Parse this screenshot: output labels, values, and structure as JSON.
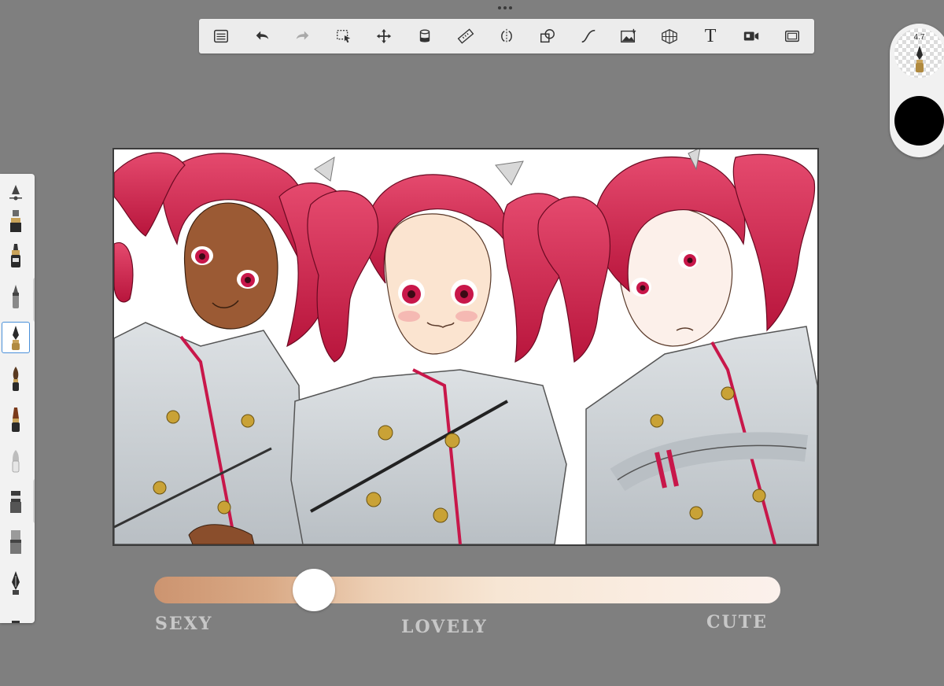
{
  "toolbar": {
    "tools": [
      {
        "name": "list-icon",
        "label": ""
      },
      {
        "name": "undo-icon",
        "label": ""
      },
      {
        "name": "redo-icon",
        "label": ""
      },
      {
        "name": "selection-icon",
        "label": ""
      },
      {
        "name": "move-icon",
        "label": ""
      },
      {
        "name": "fill-icon",
        "label": ""
      },
      {
        "name": "ruler-icon",
        "label": ""
      },
      {
        "name": "symmetry-icon",
        "label": ""
      },
      {
        "name": "shapes-icon",
        "label": ""
      },
      {
        "name": "curve-icon",
        "label": ""
      },
      {
        "name": "image-icon",
        "label": ""
      },
      {
        "name": "perspective-icon",
        "label": ""
      },
      {
        "name": "text-tool",
        "label": "T"
      },
      {
        "name": "record-icon",
        "label": ""
      },
      {
        "name": "fullscreen-icon",
        "label": ""
      }
    ]
  },
  "puck": {
    "brush_size": "4.7",
    "current_color": "#000000"
  },
  "palette": {
    "brushes": [
      "pencil",
      "marker",
      "ink-pen",
      "fine-pen",
      "nib-pen",
      "round-brush",
      "flat-brush",
      "airbrush",
      "eraser",
      "smudge",
      "fountain-pen",
      "paint"
    ],
    "selected_index": 4
  },
  "artwork": {
    "hair_color": "#d8234f",
    "uniform_color": "#cdd2d6"
  },
  "tone_slider": {
    "value": 0.26,
    "labels": {
      "left": "SEXY",
      "middle": "LOVELY",
      "right": "CUTE"
    },
    "start_color": "#cc9470",
    "end_color": "#fbf1ec"
  }
}
